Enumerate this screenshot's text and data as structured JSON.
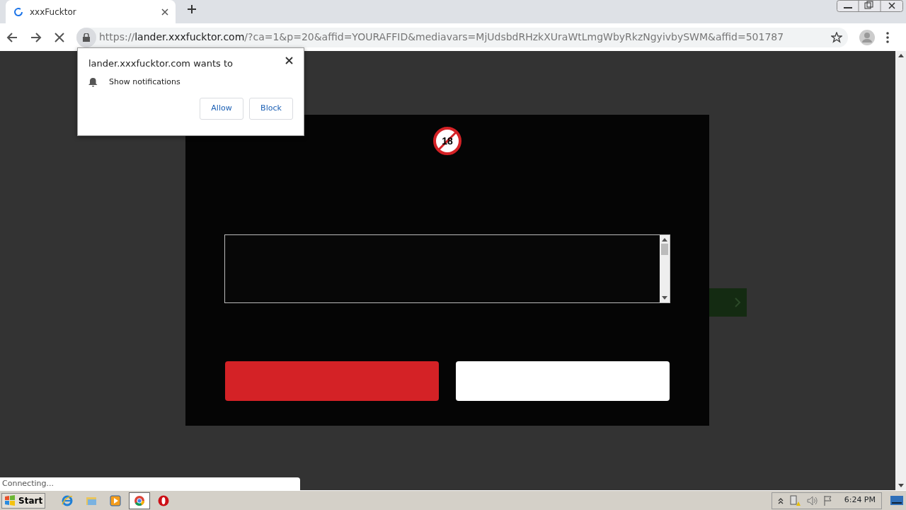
{
  "tab": {
    "title": "xxxFucktor",
    "loading": true
  },
  "address": {
    "scheme": "https://",
    "host": "lander.xxxfucktor.com",
    "rest": "/?ca=1&p=20&affid=YOURAFFID&mediavars=MjUdsbdRHzkXUraWtLmgWbyRkzNgyivbySWM&affid=501787"
  },
  "permission_prompt": {
    "title": "lander.xxxfucktor.com wants to",
    "permission": "Show notifications",
    "buttons": [
      "Allow",
      "Block"
    ]
  },
  "modal": {
    "age_badge": "18",
    "buttons": [
      {
        "kind": "primary"
      },
      {
        "kind": "secondary"
      }
    ]
  },
  "status_bar": "Connecting...",
  "taskbar": {
    "start": "Start",
    "apps": [
      {
        "kind": "ie",
        "selected": false
      },
      {
        "kind": "folder",
        "selected": false
      },
      {
        "kind": "media",
        "selected": false
      },
      {
        "kind": "chrome",
        "selected": true
      },
      {
        "kind": "opera",
        "selected": false
      }
    ],
    "clock": "6:24 PM"
  }
}
